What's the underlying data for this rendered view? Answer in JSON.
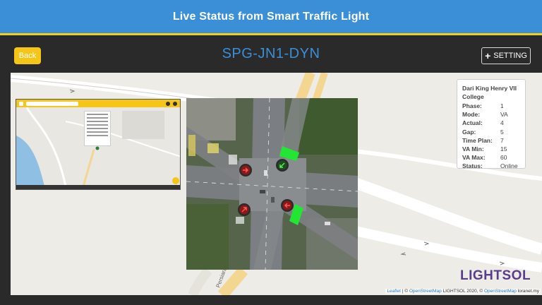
{
  "banner": {
    "title": "Live Status from Smart Traffic Light"
  },
  "toolbar": {
    "back_label": "Back",
    "device_id": "SPG-JN1-DYN",
    "setting_label": "SETTING"
  },
  "info": {
    "title": "Dari King Henry VII College",
    "rows": [
      {
        "label": "Phase:",
        "value": "1"
      },
      {
        "label": "Mode:",
        "value": "VA"
      },
      {
        "label": "Actual:",
        "value": "4"
      },
      {
        "label": "Gap:",
        "value": "5"
      },
      {
        "label": "Time Plan:",
        "value": "7"
      },
      {
        "label": "VA Min:",
        "value": "15"
      },
      {
        "label": "VA Max:",
        "value": "60"
      },
      {
        "label": "Status:",
        "value": "Online"
      }
    ]
  },
  "map": {
    "road_label": "Persiaran",
    "logo": "LIGHTSOL",
    "attribution": {
      "leaflet": "Leaflet",
      "sep1": " | © ",
      "osm1": "OpenStreetMap",
      "mid": " LIGHTSOL 2020, © ",
      "osm2": "OpenStreetMap",
      "tail": " loranet.my"
    }
  },
  "signals": [
    {
      "name": "signal-nw",
      "state": "red",
      "arrow": "right"
    },
    {
      "name": "signal-ne",
      "state": "green",
      "arrow": "down-left"
    },
    {
      "name": "signal-sw",
      "state": "red",
      "arrow": "up-right"
    },
    {
      "name": "signal-se",
      "state": "red",
      "arrow": "left"
    }
  ],
  "colors": {
    "banner": "#3a8fd6",
    "accent": "#f5c518",
    "device_id": "#3a8fd6",
    "logo": "#5a3c8c",
    "green_phase": "#22e633"
  }
}
